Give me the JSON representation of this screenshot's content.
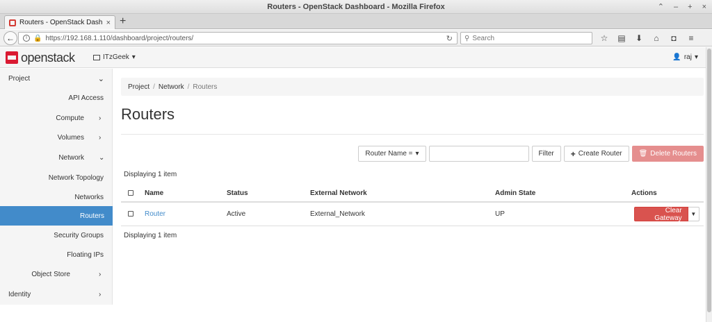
{
  "window": {
    "title": "Routers - OpenStack Dashboard - Mozilla Firefox",
    "controls": [
      "⌃",
      "–",
      "+",
      "×"
    ]
  },
  "browser": {
    "tab_title": "Routers - OpenStack Dashb",
    "tab_close": "×",
    "new_tab": "+",
    "back": "←",
    "url": "https://192.168.1.110/dashboard/project/routers/",
    "search_placeholder": "Search",
    "toolbar_icons": [
      "bookmark-star-icon",
      "reading-list-icon",
      "download-icon",
      "home-icon",
      "pocket-icon",
      "menu-icon"
    ]
  },
  "header": {
    "logo_text": "openstack",
    "logo_registered": ".",
    "project": "ITzGeek",
    "user": "raj"
  },
  "sidebar": {
    "project": "Project",
    "api_access": "API Access",
    "compute": "Compute",
    "volumes": "Volumes",
    "network": "Network",
    "network_topology": "Network Topology",
    "networks": "Networks",
    "routers": "Routers",
    "security_groups": "Security Groups",
    "floating_ips": "Floating IPs",
    "object_store": "Object Store",
    "identity": "Identity"
  },
  "breadcrumb": {
    "items": [
      "Project",
      "Network",
      "Routers"
    ],
    "separator": "/"
  },
  "page": {
    "title": "Routers"
  },
  "actions": {
    "filter_field": "Router Name =",
    "filter_value": "",
    "filter_button": "Filter",
    "create_button": "Create Router",
    "delete_button": "Delete Routers"
  },
  "table": {
    "count_top": "Displaying 1 item",
    "count_bottom": "Displaying 1 item",
    "columns": [
      "Name",
      "Status",
      "External Network",
      "Admin State",
      "Actions"
    ],
    "rows": [
      {
        "name": "Router",
        "status": "Active",
        "external_network": "External_Network",
        "admin_state": "UP",
        "action": "Clear Gateway"
      }
    ]
  },
  "colors": {
    "accent": "#428bca",
    "danger": "#d9534f",
    "brand": "#da1a32"
  }
}
